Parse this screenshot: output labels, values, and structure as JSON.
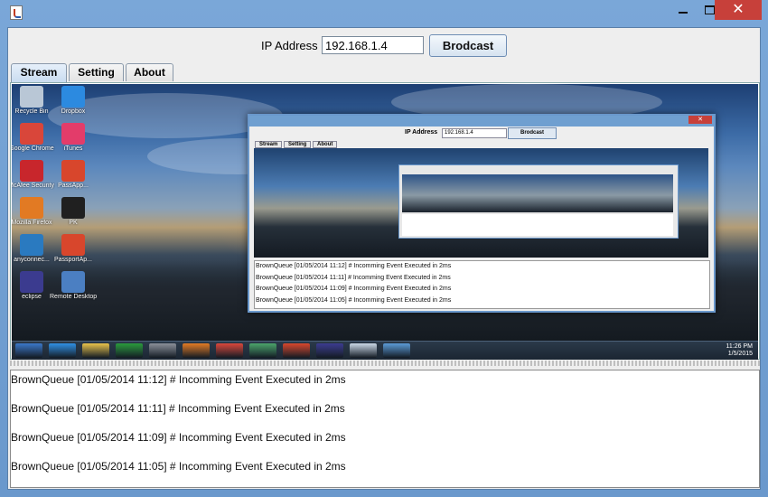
{
  "window": {
    "icon": "java-cup-icon",
    "buttons": {
      "minimize": "minimize-icon",
      "maximize": "maximize-icon",
      "close": "✕"
    }
  },
  "ip": {
    "label": "IP Address",
    "value": "192.168.1.4"
  },
  "broadcast_button": "Brodcast",
  "tabs": [
    "Stream",
    "Setting",
    "About"
  ],
  "active_tab": "Stream",
  "desktop_icons": [
    {
      "label": "Recycle Bin",
      "icon": "recycle-bin-icon",
      "color": "#b9c7d6"
    },
    {
      "label": "Dropbox",
      "icon": "dropbox-icon",
      "color": "#2c8ae0"
    },
    {
      "label": "Google Chrome",
      "icon": "chrome-icon",
      "color": "#d9463a"
    },
    {
      "label": "iTunes",
      "icon": "itunes-icon",
      "color": "#e33c6a"
    },
    {
      "label": "McAfee Security Sc...",
      "icon": "mcafee-icon",
      "color": "#c8262c"
    },
    {
      "label": "PassApp...",
      "icon": "passapp-icon",
      "color": "#d8462c"
    },
    {
      "label": "Mozilla Firefox",
      "icon": "firefox-icon",
      "color": "#e27a23"
    },
    {
      "label": "PK",
      "icon": "pk-icon",
      "color": "#202020"
    },
    {
      "label": "anyconnec...",
      "icon": "anyconnect-icon",
      "color": "#2a7ac0"
    },
    {
      "label": "PassportAp...",
      "icon": "passport-icon",
      "color": "#d8462c"
    },
    {
      "label": "eclipse",
      "icon": "eclipse-icon",
      "color": "#3b3b8f"
    },
    {
      "label": "Remote Desktop",
      "icon": "remote-desktop-icon",
      "color": "#4b7fc2"
    }
  ],
  "taskbar": {
    "items": [
      {
        "icon": "windows-start-icon",
        "color": "#3a77c8"
      },
      {
        "icon": "internet-explorer-icon",
        "color": "#2f8fe3"
      },
      {
        "icon": "file-explorer-icon",
        "color": "#e8c24a"
      },
      {
        "icon": "store-icon",
        "color": "#2a9a3c"
      },
      {
        "icon": "network-icon",
        "color": "#8a8f98"
      },
      {
        "icon": "firefox-icon",
        "color": "#e27a23"
      },
      {
        "icon": "chrome-icon",
        "color": "#d9463a"
      },
      {
        "icon": "globe-icon",
        "color": "#4aa36a"
      },
      {
        "icon": "passapp-icon",
        "color": "#d8462c"
      },
      {
        "icon": "eclipse-icon",
        "color": "#3b3b8f"
      },
      {
        "icon": "java-icon",
        "color": "#c9d7e6"
      },
      {
        "icon": "monitor-icon",
        "color": "#5b9ad5"
      }
    ],
    "time": "11:26 PM",
    "date": "1/5/2015"
  },
  "nested_window": {
    "ip_label": "IP Address",
    "ip_value": "192.168.1.4",
    "button": "Brodcast",
    "tabs": [
      "Stream",
      "Setting",
      "About"
    ],
    "log": [
      "BrownQueue [01/05/2014 11:12]  #  Incomming Event Executed in 2ms",
      "BrownQueue [01/05/2014 11:11]  #  Incomming Event Executed in 2ms",
      "BrownQueue [01/05/2014 11:09]  #  Incomming Event Executed in 2ms",
      "BrownQueue [01/05/2014 11:05]  #  Incomming Event Executed in 2ms"
    ]
  },
  "log": [
    "BrownQueue [01/05/2014 11:12]  #  Incomming Event Executed in 2ms",
    "BrownQueue [01/05/2014 11:11]  #  Incomming Event Executed in 2ms",
    "BrownQueue [01/05/2014 11:09]  #  Incomming Event Executed in 2ms",
    "BrownQueue [01/05/2014 11:05]  #  Incomming Event Executed in 2ms"
  ]
}
